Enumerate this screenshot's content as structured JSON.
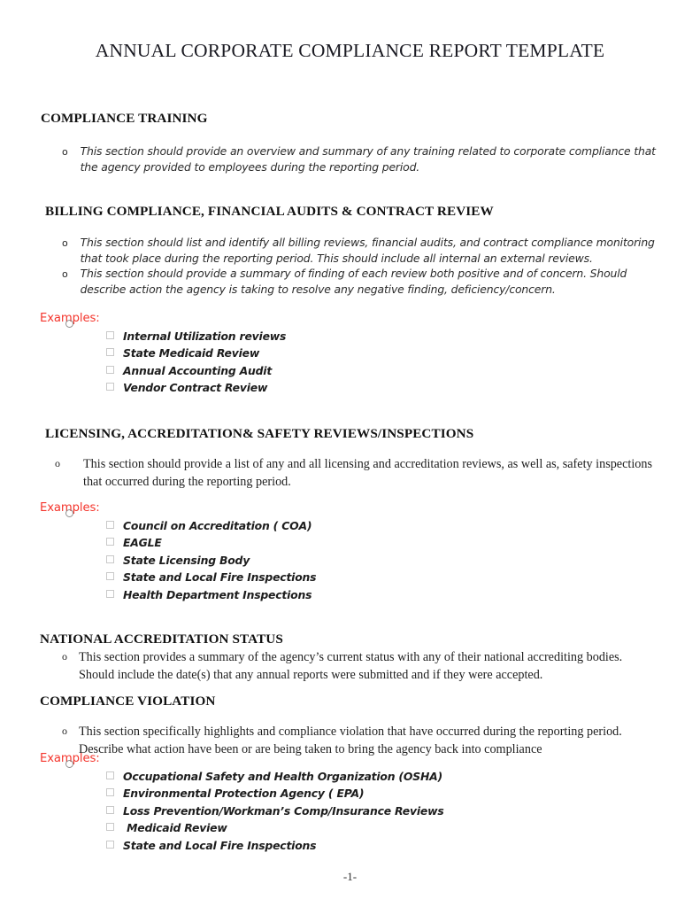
{
  "document": {
    "title": "ANNUAL CORPORATE COMPLIANCE REPORT TEMPLATE",
    "footer_page_number": "-1-",
    "accent_red": "#f4352c",
    "text_color": "#1b1b1b",
    "background": "#ffffff"
  },
  "sections": [
    {
      "heading": "COMPLIANCE TRAINING",
      "bullets": [
        "This section should provide an overview and summary of any training related to corporate compliance that the agency provided to employees during the reporting period."
      ],
      "examples_label": null,
      "examples": []
    },
    {
      "heading": "BILLING COMPLIANCE, FINANCIAL AUDITS & CONTRACT REVIEW",
      "bullets": [
        "This section should list and identify all billing reviews, financial audits, and contract compliance monitoring that took place during the reporting period. This should include all internal an external reviews.",
        "This section should provide a summary of finding of each review both positive and of concern. Should describe action the agency is taking to resolve any negative finding, deficiency/concern."
      ],
      "examples_label": "Examples:",
      "examples": [
        "Internal Utilization reviews",
        "State Medicaid Review",
        "Annual Accounting Audit",
        "Vendor Contract Review"
      ]
    },
    {
      "heading": "LICENSING, ACCREDITATION& SAFETY REVIEWS/INSPECTIONS",
      "bullets": [
        "This section should provide a list of any and all licensing and accreditation reviews, as well as, safety inspections that occurred during the reporting period."
      ],
      "examples_label": "Examples:",
      "examples": [
        "Council on Accreditation ( COA)",
        "EAGLE",
        "State Licensing Body",
        "State and Local Fire Inspections",
        "Health Department Inspections"
      ]
    },
    {
      "heading": "NATIONAL ACCREDITATION STATUS",
      "bullets": [
        "This section provides a summary of the agency’s current status with any of their national accrediting bodies.  Should include the date(s)  that any annual reports were submitted and if they were accepted."
      ],
      "examples_label": null,
      "examples": []
    },
    {
      "heading": "COMPLIANCE VIOLATION",
      "bullets": [
        "This section specifically highlights and compliance violation that have occurred during the reporting period.  Describe what action have been or are being taken to bring the agency back into compliance"
      ],
      "examples_label": "Examples:",
      "examples": [
        "Occupational Safety and Health Organization (OSHA)",
        "Environmental Protection Agency ( EPA)",
        "Loss Prevention/Workman’s Comp/Insurance Reviews",
        " Medicaid Review",
        "State and Local Fire Inspections"
      ]
    }
  ],
  "markers": {
    "bullet_glyph": "o",
    "checkbox_glyph": "☐"
  }
}
